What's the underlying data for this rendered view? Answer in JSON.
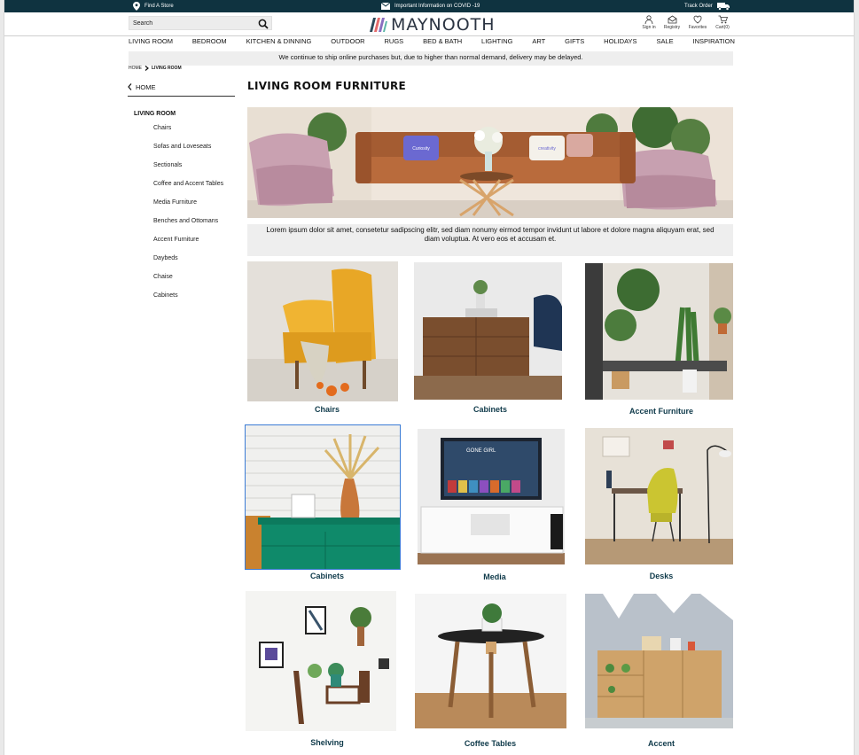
{
  "topbar": {
    "find_store": "Find A Store",
    "covid_info": "Important Information on COVID -19",
    "track_order": "Track Order"
  },
  "header": {
    "search_placeholder": "Search",
    "logo_text": "MAYNOOTH",
    "utilities": {
      "sign_in": "Sign in",
      "registry": "Registry",
      "favorites": "Favorites",
      "cart": "Cart(0)"
    }
  },
  "nav": [
    "LIVING ROOM",
    "BEDROOM",
    "KITCHEN & DINNING",
    "OUTDOOR",
    "RUGS",
    "BED & BATH",
    "LIGHTING",
    "ART",
    "GIFTS",
    "HOLIDAYS",
    "SALE",
    "INSPIRATION"
  ],
  "notice": "We continue to ship online purchases but, due to higher than normal demand, delivery may be delayed.",
  "breadcrumb": {
    "home": "HOME",
    "current": "LIVING ROOM"
  },
  "sidebar": {
    "back_label": "HOME",
    "section_title": "LIVING ROOM",
    "items": [
      "Chairs",
      "Sofas and Loveseats",
      "Sectionals",
      "Coffee and Accent Tables",
      "Media Furniture",
      "Benches and Ottomans",
      "Accent Furniture",
      "Daybeds",
      "Chaise",
      "Cabinets"
    ]
  },
  "main": {
    "title": "LIVING ROOM FURNITURE",
    "hero_caption": "Lorem ipsum dolor sit amet, consetetur sadipscing elitr, sed diam nonumy eirmod tempor invidunt ut labore et dolore magna aliquyam erat, sed diam voluptua. At vero eos et accusam et.",
    "hero_pillows": [
      "Curiosity",
      "creativity"
    ],
    "tiles": [
      "Chairs",
      "Cabinets",
      "Accent Furniture",
      "Cabinets",
      "Media",
      "Desks",
      "Shelving",
      "Coffee Tables",
      "Accent"
    ],
    "tv_text": "GONE GIRL"
  },
  "colors": {
    "topbar": "#0f3340",
    "tile_label": "#0f3a4a",
    "notice_bg": "#eeeeee"
  }
}
